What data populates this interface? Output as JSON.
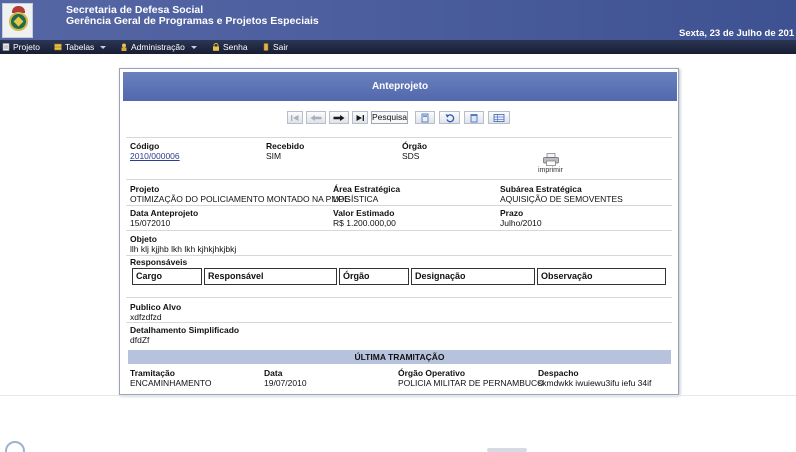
{
  "header": {
    "title_line1": "Secretaria de Defesa Social",
    "title_line2": "Gerência Geral de Programas e Projetos Especiais",
    "date": "Sexta, 23 de Julho de 201"
  },
  "menu": [
    {
      "label": "Projeto",
      "icon": "document-icon"
    },
    {
      "label": "Tabelas",
      "icon": "table-icon"
    },
    {
      "label": "Administração",
      "icon": "admin-icon"
    },
    {
      "label": "Senha",
      "icon": "lock-icon"
    },
    {
      "label": "Sair",
      "icon": "exit-icon"
    }
  ],
  "panel": {
    "title": "Anteprojeto",
    "toolbar": {
      "search_label": "Pesquisa"
    },
    "fields": {
      "codigo_label": "Código",
      "codigo_value": "2010/000006",
      "recebido_label": "Recebido",
      "recebido_value": "SIM",
      "orgao_label": "Órgão",
      "orgao_value": "SDS",
      "print_label": "imprimir",
      "projeto_label": "Projeto",
      "projeto_value": "OTIMIZAÇÃO DO POLICIAMENTO MONTADO NA PMPE",
      "area_label": "Área Estratégica",
      "area_value": "LOGÍSTICA",
      "subarea_label": "Subárea Estratégica",
      "subarea_value": "AQUISIÇÃO DE SEMOVENTES",
      "data_label": "Data Anteprojeto",
      "data_value": "15/072010",
      "valor_label": "Valor Estimado",
      "valor_value": "R$ 1.200.000,00",
      "prazo_label": "Prazo",
      "prazo_value": "Julho/2010",
      "objeto_label": "Objeto",
      "objeto_value": "llh klj kjjhb lkh lkh kjhkjhkjbkj",
      "responsaveis_label": "Responsáveis",
      "publico_label": "Publico Alvo",
      "publico_value": "xdfzdfzd",
      "detalhamento_label": "Detalhamento Simplificado",
      "detalhamento_value": "dfdZf"
    },
    "responsaveis_columns": [
      "Cargo",
      "Responsável",
      "Órgão",
      "Designação",
      "Observação"
    ],
    "ultima": {
      "heading": "ÚLTIMA TRAMITAÇÃO",
      "tramitacao_label": "Tramitação",
      "tramitacao_value": "ENCAMINHAMENTO",
      "data_label": "Data",
      "data_value": "19/07/2010",
      "orgao_label": "Órgão Operativo",
      "orgao_value": "POLICIA MILITAR DE PERNAMBUCO",
      "despacho_label": "Despacho",
      "despacho_value": "skmdwkk iwuiewu3ifu iefu 34if"
    }
  }
}
